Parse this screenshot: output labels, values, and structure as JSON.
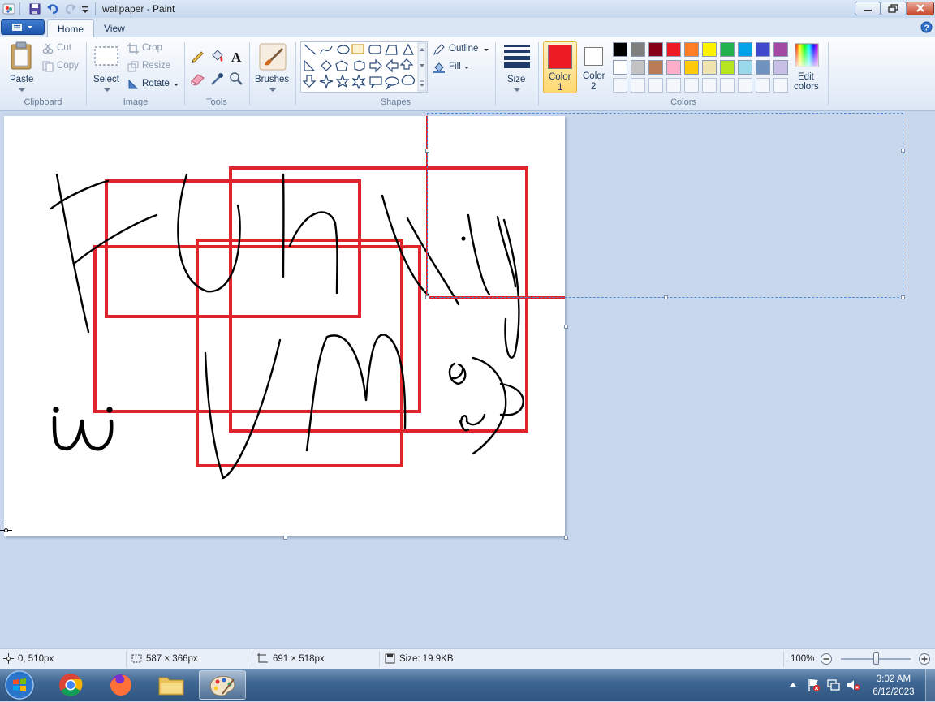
{
  "window": {
    "title": "wallpaper - Paint"
  },
  "tabs": [
    {
      "label": "Home"
    },
    {
      "label": "View"
    }
  ],
  "ribbon": {
    "clipboard": {
      "label": "Clipboard",
      "paste": "Paste",
      "cut": "Cut",
      "copy": "Copy"
    },
    "image": {
      "label": "Image",
      "select": "Select",
      "crop": "Crop",
      "resize": "Resize",
      "rotate": "Rotate"
    },
    "tools": {
      "label": "Tools"
    },
    "brushes": {
      "label": "Brushes"
    },
    "shapes": {
      "label": "Shapes",
      "outline": "Outline",
      "fill": "Fill"
    },
    "size": {
      "label": "Size"
    },
    "colors": {
      "label": "Colors",
      "color1": "Color",
      "color1_num": "1",
      "color2": "Color",
      "color2_num": "2",
      "edit1": "Edit",
      "edit2": "colors",
      "color1_value": "#ed1c24",
      "color2_value": "#ffffff",
      "palette_row1": [
        "#000000",
        "#7f7f7f",
        "#880015",
        "#ed1c24",
        "#ff7f27",
        "#fff200",
        "#22b14c",
        "#00a2e8",
        "#3f48cc",
        "#a349a4"
      ],
      "palette_row2": [
        "#ffffff",
        "#c3c3c3",
        "#b97a57",
        "#ffaec9",
        "#ffc90e",
        "#efe4b0",
        "#b5e61d",
        "#99d9ea",
        "#7092be",
        "#c8bfe7"
      ]
    }
  },
  "status": {
    "cursor_pos": "0, 510px",
    "selection_size": "587 × 366px",
    "image_size": "691 × 518px",
    "file_size": "Size: 19.9KB",
    "zoom": "100%",
    "zoom_fraction": 0.5
  },
  "taskbar": {
    "time": "3:02 AM",
    "date": "6/12/2023"
  }
}
